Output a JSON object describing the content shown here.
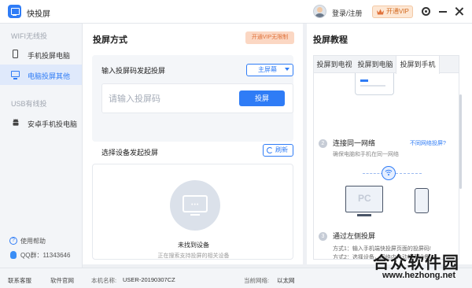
{
  "titlebar": {
    "app_title": "快投屏",
    "login_label": "登录/注册",
    "vip_label": "开通VIP",
    "icons": [
      "app-logo-icon",
      "avatar",
      "crown-icon",
      "settings-icon",
      "minimize-icon",
      "close-icon"
    ]
  },
  "sidebar": {
    "wifi_section": "WIFI无线投",
    "usb_section": "USB有线投",
    "items": [
      {
        "label": "手机投屏电脑",
        "icon": "phone-icon"
      },
      {
        "label": "电脑投屏其他",
        "icon": "monitor-icon",
        "active": true
      },
      {
        "label": "安卓手机投电脑",
        "icon": "android-icon"
      }
    ],
    "help_label": "使用帮助",
    "qq_label": "QQ群：11343646"
  },
  "main": {
    "title": "投屏方式",
    "vip_unlimited_label": "开通VIP无限制",
    "code_section_title": "输入投屏码发起投屏",
    "mode_select_value": "主屏幕",
    "code_placeholder": "请输入投屏码",
    "cast_button_label": "投屏",
    "device_section_title": "选择设备发起投屏",
    "refresh_label": "刷新",
    "no_device_title": "未找到设备",
    "no_device_sub": "正在搜索支持投屏的相关设备"
  },
  "tutorial": {
    "title": "投屏教程",
    "tabs": [
      {
        "label": "投屏到电视"
      },
      {
        "label": "投屏到电脑"
      },
      {
        "label": "投屏到手机",
        "active": true
      }
    ],
    "step2_num": "2",
    "step2_title": "连接同一网络",
    "step2_sub": "确保电脑和手机在同一网络",
    "network_link": "不同网络投屏?",
    "pc_label": "PC",
    "step3_num": "3",
    "step3_title": "通过左侧投屏",
    "step3_line1": "方式1：输入手机端快投屏页面的投屏码!",
    "step3_line2": "方式2：选择设备，网络内自动搜索设备。"
  },
  "statusbar": {
    "feedback_label": "联系客服",
    "website_label": "软件官网",
    "machine_name_label": "本机名称:",
    "machine_name_value": "USER-20190307CZ",
    "network_label": "当前网络:",
    "network_value": "以太网"
  },
  "watermark": {
    "text_cn": "合众软件园",
    "url": "www.hezhong.net"
  },
  "colors": {
    "accent": "#2f7cf6",
    "vip": "#e0723a",
    "sidebar_bg": "#f3f5f8",
    "active_bg": "#dfe9fb"
  }
}
